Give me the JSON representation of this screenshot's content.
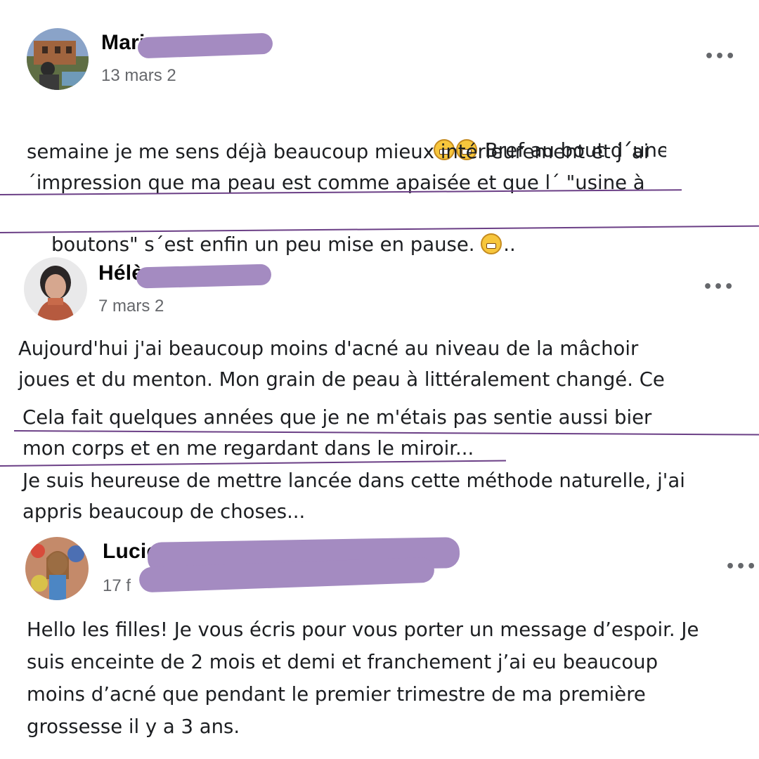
{
  "posts": [
    {
      "author": "Mari",
      "date": "13 mars 2",
      "more": "•••",
      "lines": [
        "Bref au bout d´une",
        "semaine je me sens déjà beaucoup mieux intérieurement et j´ai",
        "´impression que ma peau est comme apaisée et que l´ \"usine à",
        "boutons\" s´est enfin un peu mise en pause.",
        ".."
      ],
      "emoji_1": "grinning-sweat-emoji",
      "emoji_2": "grimacing-emoji"
    },
    {
      "author": "Hélè",
      "date": "7 mars 2",
      "more": "•••",
      "lines": [
        "Aujourd'hui j'ai beaucoup moins d'acné au niveau de la mâchoir",
        "joues et du menton. Mon grain de peau à littéralement changé. Ce",
        "Cela fait quelques années que je ne m'étais pas sentie aussi bier",
        "mon corps et en me regardant dans le miroir...",
        "Je suis heureuse de mettre lancée dans cette méthode naturelle, j'ai",
        "appris beaucoup de choses..."
      ]
    },
    {
      "author": "Lucie",
      "date": "17 f",
      "more": "•••",
      "lines": [
        "Hello les filles! Je vous écris pour vous porter un message d’espoir. Je",
        "suis enceinte de 2 mois et demi et franchement j’ai eu beaucoup",
        "moins d’acné que pendant le premier trimestre de ma première",
        "grossesse il y a 3 ans."
      ]
    }
  ],
  "colors": {
    "redaction": "#a48bc1",
    "underline": "#6b3f86",
    "date": "#65676b"
  }
}
